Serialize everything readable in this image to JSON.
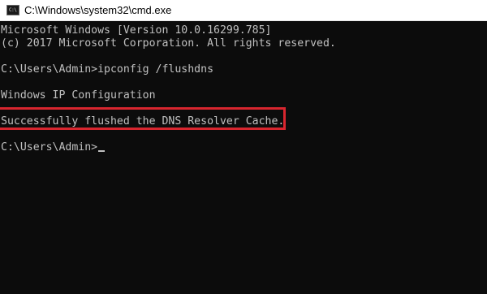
{
  "window": {
    "title": "C:\\Windows\\system32\\cmd.exe",
    "icon": "cmd-icon",
    "icon_glyph": "C:\\"
  },
  "console": {
    "lines": [
      "Microsoft Windows [Version 10.0.16299.785]",
      "(c) 2017 Microsoft Corporation. All rights reserved.",
      "C:\\Users\\Admin>ipconfig /flushdns",
      "Windows IP Configuration",
      "Successfully flushed the DNS Resolver Cache.",
      "C:\\Users\\Admin>"
    ],
    "text_color": "#c0c0c0",
    "background_color": "#0c0c0c",
    "highlight_color": "#d8262f"
  }
}
